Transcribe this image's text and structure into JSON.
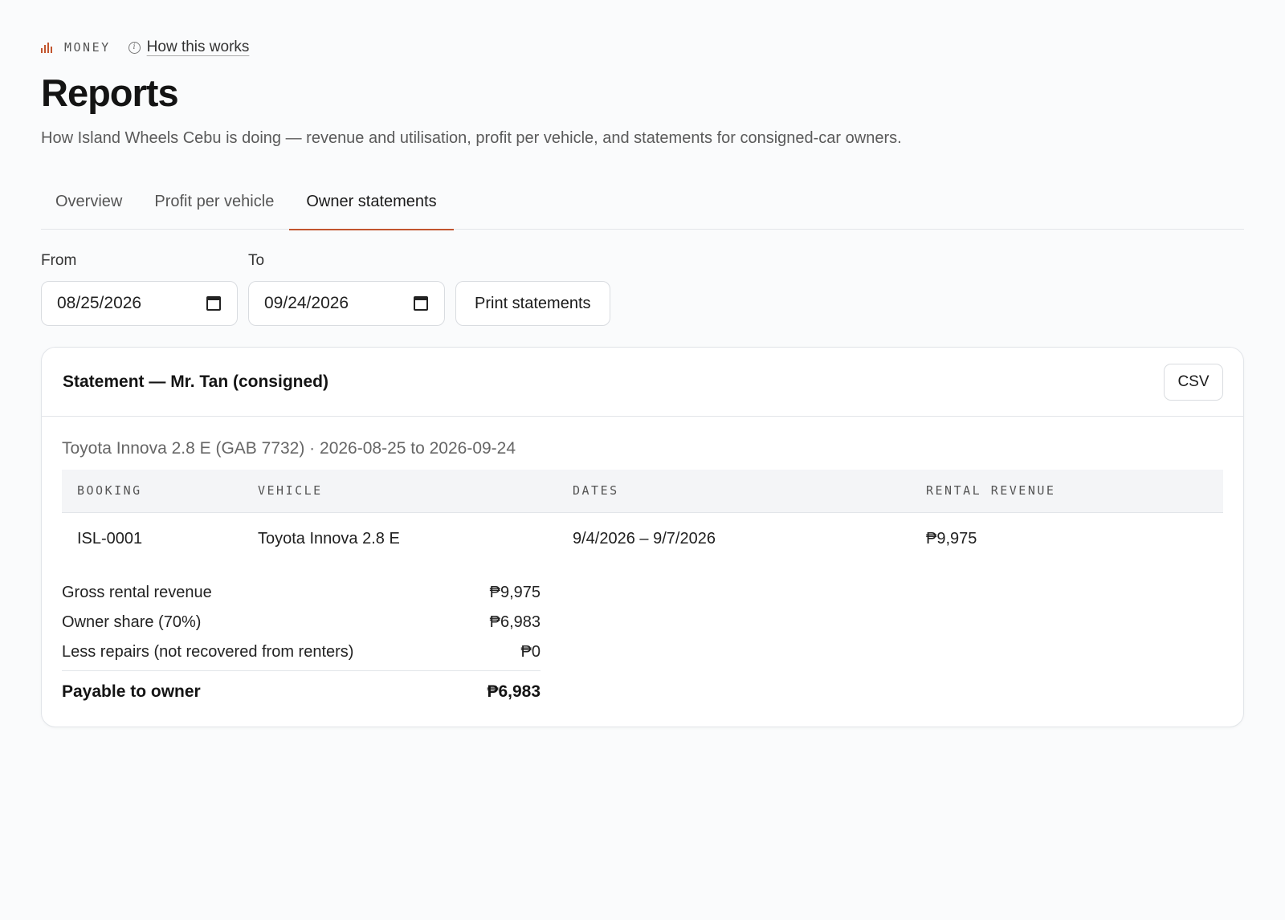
{
  "header": {
    "section": "MONEY",
    "help_link": "How this works",
    "title": "Reports",
    "subtitle": "How Island Wheels Cebu is doing — revenue and utilisation, profit per vehicle, and statements for consigned-car owners."
  },
  "tabs": [
    {
      "label": "Overview",
      "active": false
    },
    {
      "label": "Profit per vehicle",
      "active": false
    },
    {
      "label": "Owner statements",
      "active": true
    }
  ],
  "filters": {
    "from_label": "From",
    "from_value": "08/25/2026",
    "to_label": "To",
    "to_value": "09/24/2026",
    "print_label": "Print statements"
  },
  "statement": {
    "title": "Statement — Mr. Tan (consigned)",
    "csv_label": "CSV",
    "meta": "Toyota Innova 2.8 E (GAB 7732) · 2026-08-25 to 2026-09-24",
    "columns": [
      "BOOKING",
      "VEHICLE",
      "DATES",
      "RENTAL REVENUE"
    ],
    "rows": [
      [
        "ISL-0001",
        "Toyota Innova 2.8 E",
        "9/4/2026 – 9/7/2026",
        "₱9,975"
      ]
    ],
    "summary": [
      {
        "label": "Gross rental revenue",
        "value": "₱9,975"
      },
      {
        "label": "Owner share (70%)",
        "value": "₱6,983"
      },
      {
        "label": "Less repairs (not recovered from renters)",
        "value": "₱0"
      }
    ],
    "total": {
      "label": "Payable to owner",
      "value": "₱6,983"
    }
  },
  "colors": {
    "accent": "#c2552e",
    "background": "#fafbfc",
    "border": "#e2e5e9"
  },
  "icons": {
    "section": "bar-chart-icon",
    "help": "info-icon",
    "date": "calendar-icon"
  }
}
